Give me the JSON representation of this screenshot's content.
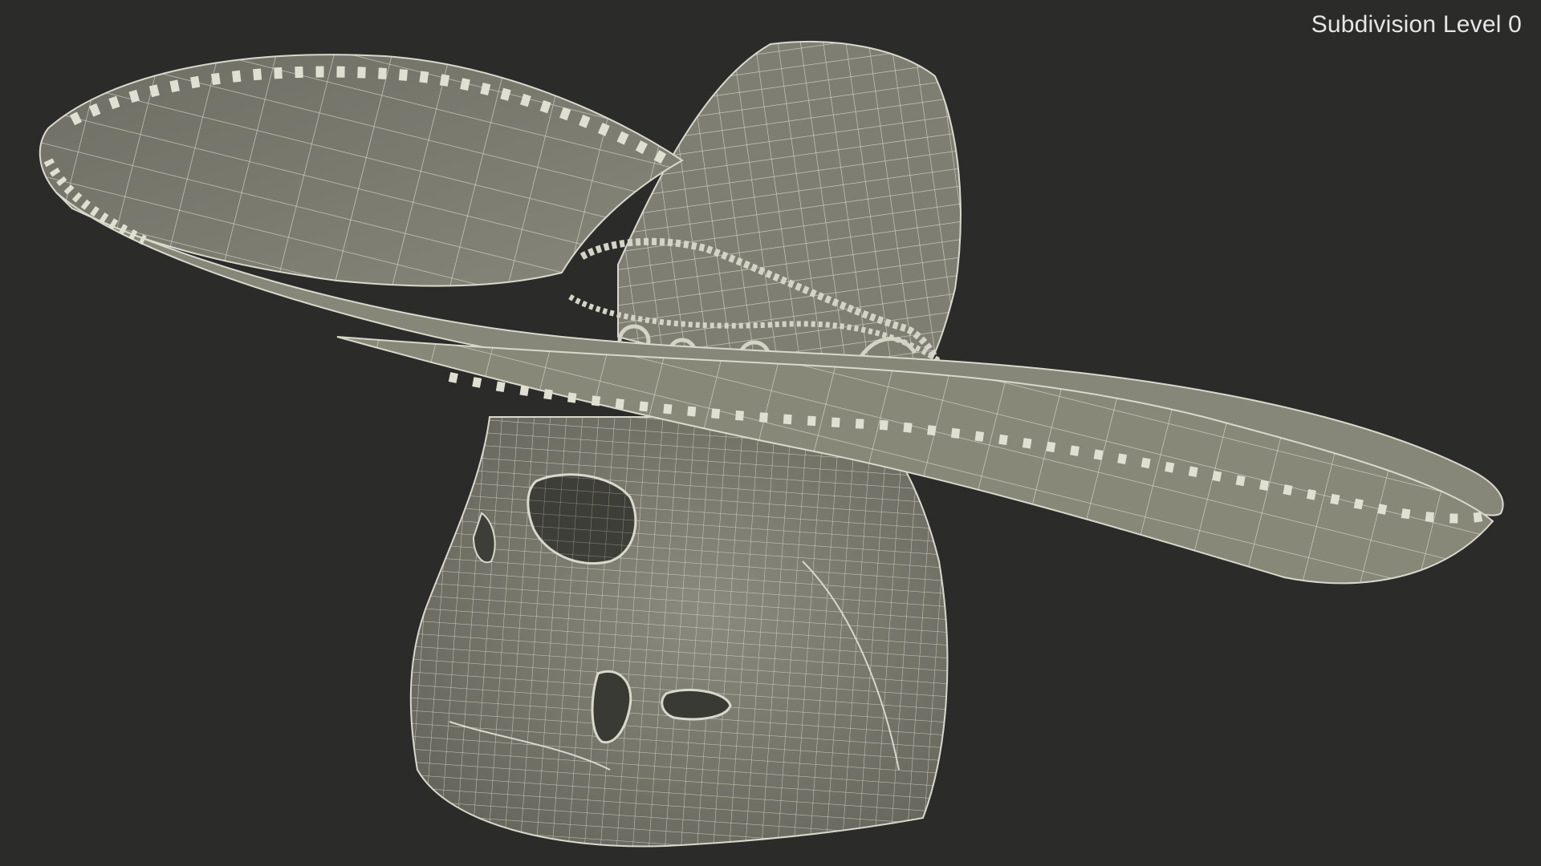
{
  "viewport": {
    "overlay_label": "Subdivision Level 0",
    "background_color": "#2b2b2a",
    "model_fill_color": "#7b7b70",
    "wire_color": "#e8e8dc"
  }
}
